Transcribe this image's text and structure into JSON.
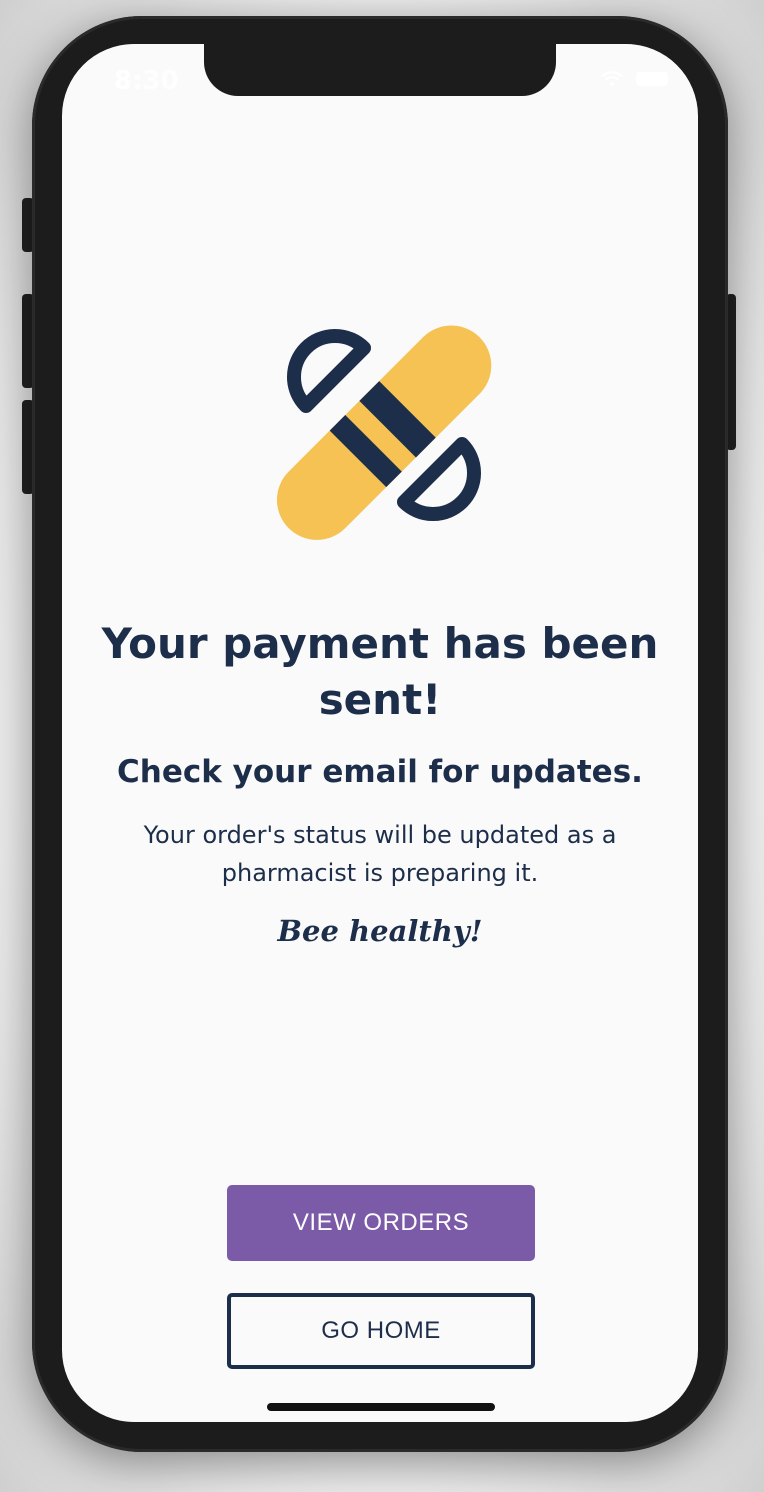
{
  "status_bar": {
    "time": "8:30",
    "icons": [
      "wifi-icon",
      "battery-icon"
    ]
  },
  "logo": {
    "icon": "capsule-pill-icon",
    "colors": {
      "navy": "#1d2e4a",
      "yellow": "#f5c253"
    }
  },
  "confirmation": {
    "title": "Your payment has been sent!",
    "subtitle": "Check your email for updates.",
    "body": "Your order's status will be updated as a pharmacist is preparing it.",
    "signoff": "Bee healthy!"
  },
  "actions": {
    "view_orders_label": "VIEW ORDERS",
    "go_home_label": "GO HOME"
  },
  "colors": {
    "primary": "#7b5ba8",
    "text": "#1d2e4a",
    "background": "#fafafa"
  }
}
